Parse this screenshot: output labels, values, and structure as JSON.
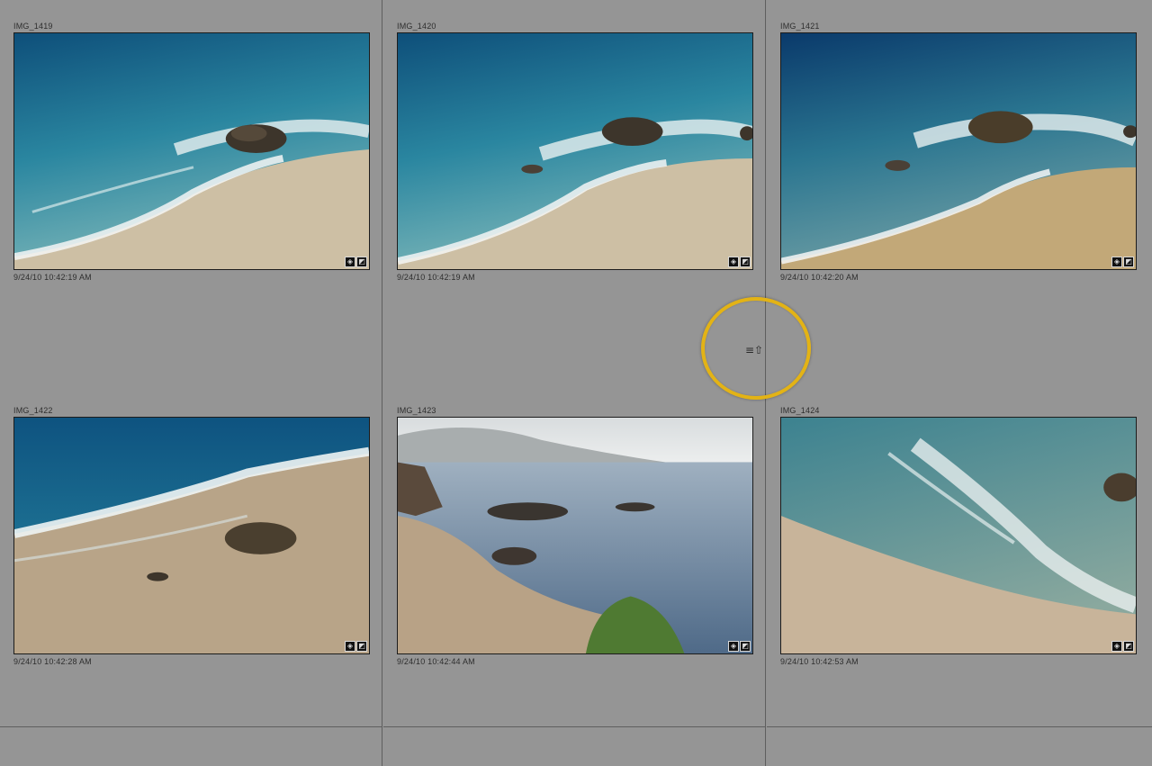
{
  "grid": {
    "cells": [
      {
        "filename": "IMG_1419",
        "date": "9/24/10 10:42:19 AM"
      },
      {
        "filename": "IMG_1420",
        "date": "9/24/10 10:42:19 AM"
      },
      {
        "filename": "IMG_1421",
        "date": "9/24/10 10:42:20 AM"
      },
      {
        "filename": "IMG_1422",
        "date": "9/24/10 10:42:28 AM"
      },
      {
        "filename": "IMG_1423",
        "date": "9/24/10 10:42:44 AM"
      },
      {
        "filename": "IMG_1424",
        "date": "9/24/10 10:42:53 AM"
      }
    ]
  },
  "badges": {
    "metadata_icon": "metadata-badge-icon",
    "develop_icon": "develop-adjusted-icon"
  },
  "overlay": {
    "sort_icon": "sort-direction-icon",
    "sort_glyph": "≡⇧",
    "highlight_color": "#e3b315"
  },
  "colors": {
    "background": "#959595",
    "divider": "#5f5f5f"
  }
}
